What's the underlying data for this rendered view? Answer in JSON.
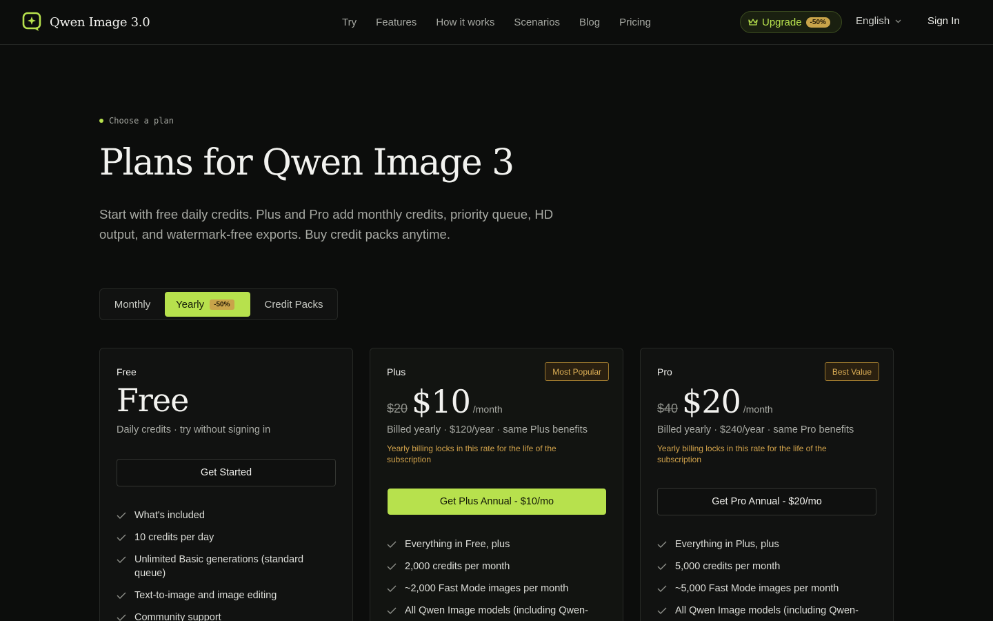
{
  "header": {
    "brand": "Qwen Image 3.0",
    "nav": [
      "Try",
      "Features",
      "How it works",
      "Scenarios",
      "Blog",
      "Pricing"
    ],
    "upgrade": {
      "label": "Upgrade",
      "badge": "-50%"
    },
    "language": "English",
    "sign_in": "Sign In"
  },
  "hero": {
    "eyebrow": "Choose a plan",
    "title": "Plans for Qwen Image 3",
    "subtitle": "Start with free daily credits. Plus and Pro add monthly credits, priority queue, HD output, and watermark-free exports. Buy credit packs anytime."
  },
  "billing_toggle": {
    "monthly": "Monthly",
    "yearly": "Yearly",
    "yearly_badge": "-50%",
    "credit_packs": "Credit Packs",
    "selected": "Yearly"
  },
  "plans": [
    {
      "name": "Free",
      "price": "Free",
      "description": "Daily credits · try without signing in",
      "cta": "Get Started",
      "features": [
        "What's included",
        "10 credits per day",
        "Unlimited Basic generations (standard queue)",
        "Text-to-image and image editing",
        "Community support"
      ]
    },
    {
      "name": "Plus",
      "ribbon": "Most Popular",
      "old_price": "$20",
      "price": "$10",
      "period": "/month",
      "billed": "Billed yearly · $120/year · same Plus benefits",
      "note": "Yearly billing locks in this rate for the life of the subscription",
      "cta": "Get Plus Annual - $10/mo",
      "features": [
        "Everything in Free, plus",
        "2,000 credits per month",
        "~2,000 Fast Mode images per month",
        "All Qwen Image models (including Qwen-"
      ]
    },
    {
      "name": "Pro",
      "ribbon": "Best Value",
      "old_price": "$40",
      "price": "$20",
      "period": "/month",
      "billed": "Billed yearly · $240/year · same Pro benefits",
      "note": "Yearly billing locks in this rate for the life of the subscription",
      "cta": "Get Pro Annual - $20/mo",
      "features": [
        "Everything in Plus, plus",
        "5,000 credits per month",
        "~5,000 Fast Mode images per month",
        "All Qwen Image models (including Qwen-"
      ]
    }
  ],
  "icons": {
    "logo": "chat-sparkle-logo-icon",
    "upgrade": "crown-icon",
    "language": "chevron-down-icon",
    "feature": "check-icon"
  },
  "colors": {
    "background": "#0c0d0c",
    "accent": "#b7e14d",
    "badge": "#c9a44a",
    "note": "#d2a34b"
  }
}
